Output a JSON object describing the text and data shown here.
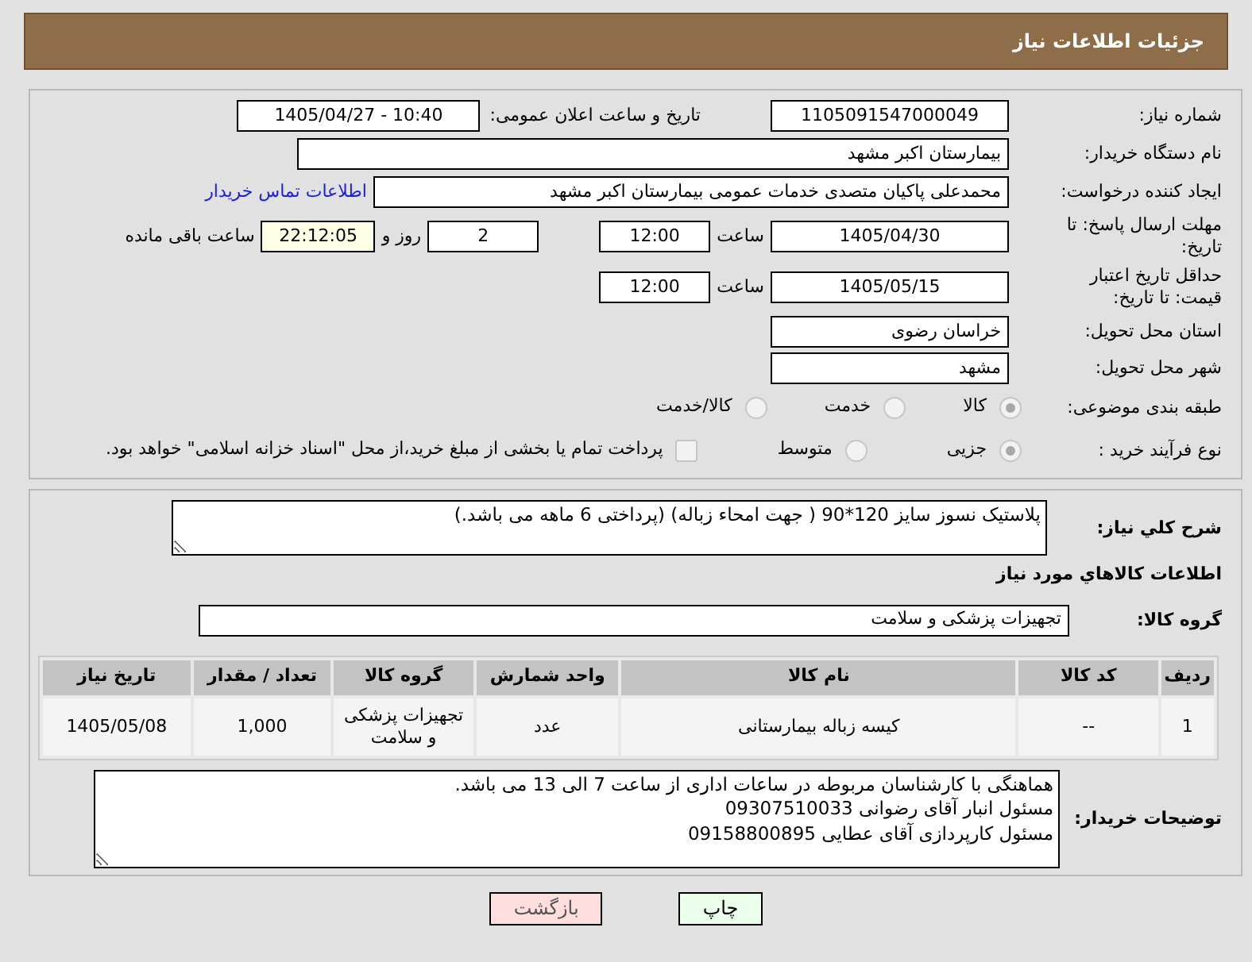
{
  "header": {
    "title": "جزئیات اطلاعات نیاز"
  },
  "details": {
    "need_number": {
      "label": "شماره نیاز:",
      "value": "1105091547000049"
    },
    "announce": {
      "label": "تاریخ و ساعت اعلان عمومی:",
      "value": "1405/04/27 - 10:40"
    },
    "buyer": {
      "label": "نام دستگاه خریدار:",
      "value": "بیمارستان اکبر مشهد"
    },
    "requester": {
      "label": "ایجاد کننده درخواست:",
      "value": "محمدعلی پاکیان متصدی خدمات عمومی بیمارستان اکبر مشهد",
      "link": "اطلاعات تماس خریدار"
    },
    "deadline": {
      "label": "مهلت ارسال پاسخ: تا تاریخ:",
      "date": "1405/04/30",
      "time_label": "ساعت",
      "time": "12:00",
      "days": "2",
      "days_label": "روز و",
      "remaining": "22:12:05",
      "remaining_label": "ساعت باقی مانده"
    },
    "validity": {
      "label": "حداقل تاریخ اعتبار قیمت: تا تاریخ:",
      "date": "1405/05/15",
      "time_label": "ساعت",
      "time": "12:00"
    },
    "province": {
      "label": "استان محل تحویل:",
      "value": "خراسان رضوی"
    },
    "city": {
      "label": "شهر محل تحویل:",
      "value": "مشهد"
    },
    "category": {
      "label": "طبقه بندی موضوعی:",
      "options": [
        {
          "label": "کالا",
          "selected": true
        },
        {
          "label": "خدمت",
          "selected": false
        },
        {
          "label": "کالا/خدمت",
          "selected": false
        }
      ]
    },
    "process": {
      "label": "نوع فرآیند خرید :",
      "options": [
        {
          "label": "جزیی",
          "selected": true
        },
        {
          "label": "متوسط",
          "selected": false
        }
      ],
      "treasury": {
        "label": "پرداخت تمام یا بخشی از مبلغ خرید،از محل \"اسناد خزانه اسلامی\" خواهد بود.",
        "checked": false
      }
    }
  },
  "items": {
    "description": {
      "label": "شرح كلي نیاز:",
      "value": "پلاستیک نسوز سایز 120*90 ( جهت امحاء زباله) (پرداختی 6 ماهه می باشد.)"
    },
    "section_title": "اطلاعات كالاهاي مورد نیاز",
    "group": {
      "label": "گروه کالا:",
      "value": "تجهیزات پزشکی و سلامت"
    },
    "table": {
      "columns": [
        "ردیف",
        "کد کالا",
        "نام کالا",
        "واحد شمارش",
        "گروه کالا",
        "تعداد / مقدار",
        "تاریخ نیاز"
      ],
      "rows": [
        [
          "1",
          "--",
          "کیسه زباله بیمارستانی",
          "عدد",
          "تجهیزات پزشکی و سلامت",
          "1,000",
          "1405/05/08"
        ]
      ]
    },
    "notes": {
      "label": "توضیحات خریدار:",
      "lines": [
        "هماهنگی با کارشناسان مربوطه در ساعات اداری از ساعت 7 الی 13 می باشد.",
        "مسئول انبار آقای رضوانی 09307510033",
        "مسئول کارپردازی آقای عطایی 09158800895"
      ]
    }
  },
  "buttons": [
    {
      "label": "چاپ",
      "kind": "print"
    },
    {
      "label": "بازگشت",
      "kind": "back"
    }
  ]
}
